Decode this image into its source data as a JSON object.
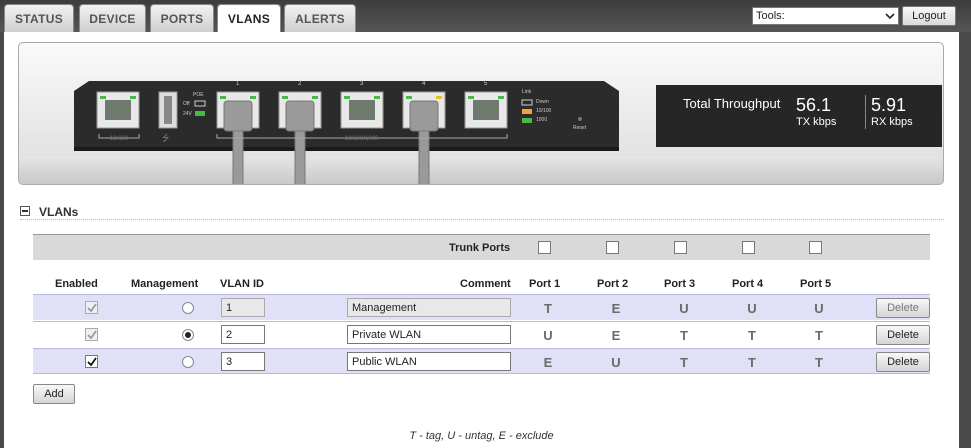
{
  "nav": {
    "tabs": [
      {
        "label": "STATUS",
        "active": false
      },
      {
        "label": "DEVICE",
        "active": false
      },
      {
        "label": "PORTS",
        "active": false
      },
      {
        "label": "VLANS",
        "active": true
      },
      {
        "label": "ALERTS",
        "active": false
      }
    ],
    "tools": {
      "selected": "Tools:"
    },
    "logout_label": "Logout"
  },
  "device": {
    "port_numbers": [
      "1",
      "2",
      "3",
      "4",
      "5"
    ],
    "labels": {
      "mgmt_speed": "10/100",
      "poe": "POE",
      "poe_off": "Off",
      "poe_24v": "24V",
      "switch_speed": "10/100/1000",
      "link": "Link",
      "down": "Down",
      "speed_10_100": "10/100",
      "speed_1000": "1000",
      "reset": "Reset"
    },
    "colors": {
      "led_green": "#4bb748",
      "led_yellow": "#e8c21a",
      "led_orange": "#f1a33a"
    }
  },
  "throughput": {
    "title": "Total Throughput",
    "tx_value": "56.1",
    "tx_unit": "TX kbps",
    "rx_value": "5.91",
    "rx_unit": "RX kbps"
  },
  "vlans": {
    "section_title": "VLANs",
    "trunk_label": "Trunk Ports",
    "trunk_ports": [
      false,
      false,
      false,
      false,
      false
    ],
    "columns": {
      "enabled": "Enabled",
      "management": "Management",
      "vlan_id": "VLAN ID",
      "comment": "Comment",
      "ports": [
        "Port 1",
        "Port 2",
        "Port 3",
        "Port 4",
        "Port 5"
      ]
    },
    "rows": [
      {
        "enabled": true,
        "enabled_disabled": true,
        "management": false,
        "vlan_id": "1",
        "comment": "Management",
        "readonly": true,
        "ports": [
          "T",
          "E",
          "U",
          "U",
          "U"
        ]
      },
      {
        "enabled": true,
        "enabled_disabled": true,
        "management": true,
        "vlan_id": "2",
        "comment": "Private WLAN",
        "readonly": false,
        "ports": [
          "U",
          "E",
          "T",
          "T",
          "T"
        ]
      },
      {
        "enabled": true,
        "enabled_disabled": false,
        "management": false,
        "vlan_id": "3",
        "comment": "Public WLAN",
        "readonly": false,
        "ports": [
          "E",
          "U",
          "T",
          "T",
          "T"
        ]
      }
    ],
    "delete_label": "Delete",
    "add_label": "Add",
    "legend": "T - tag, U - untag, E - exclude"
  }
}
